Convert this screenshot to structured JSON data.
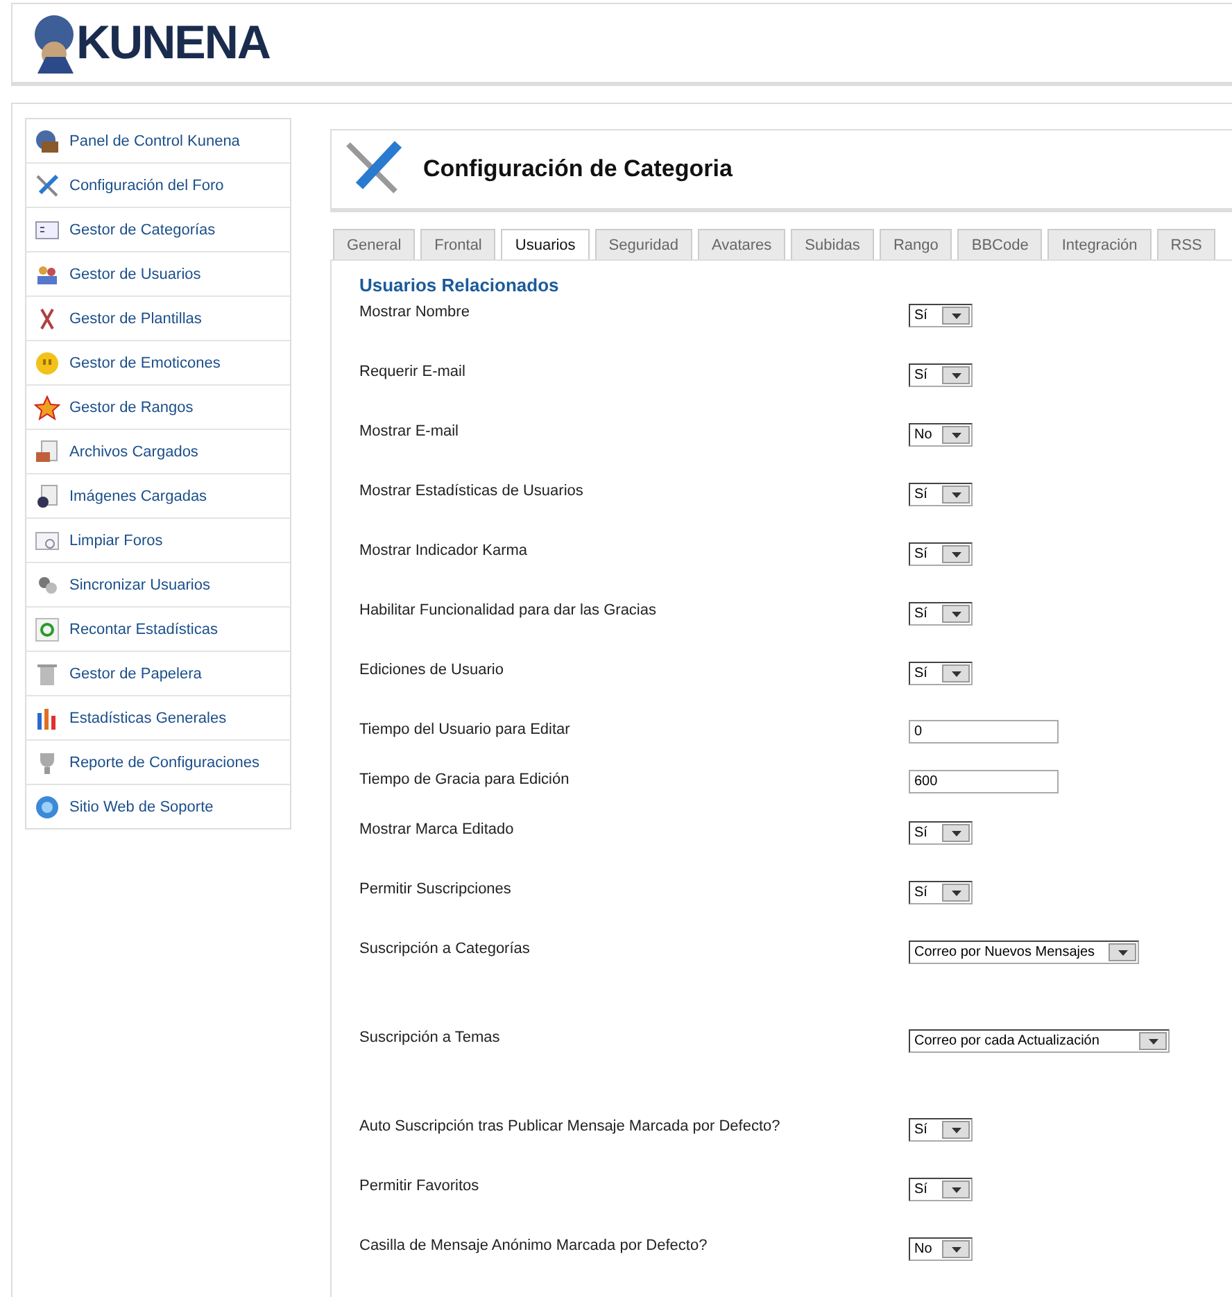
{
  "logo": {
    "text": "KUNENA"
  },
  "sidebar": {
    "items": [
      {
        "label": "Panel de Control Kunena"
      },
      {
        "label": "Configuración del Foro"
      },
      {
        "label": "Gestor de Categorías"
      },
      {
        "label": "Gestor de Usuarios"
      },
      {
        "label": "Gestor de Plantillas"
      },
      {
        "label": "Gestor de Emoticones"
      },
      {
        "label": "Gestor de Rangos"
      },
      {
        "label": "Archivos Cargados"
      },
      {
        "label": "Imágenes Cargadas"
      },
      {
        "label": "Limpiar Foros"
      },
      {
        "label": "Sincronizar Usuarios"
      },
      {
        "label": "Recontar Estadísticas"
      },
      {
        "label": "Gestor de Papelera"
      },
      {
        "label": "Estadísticas Generales"
      },
      {
        "label": "Reporte de Configuraciones"
      },
      {
        "label": "Sitio Web de Soporte"
      }
    ]
  },
  "page": {
    "title": "Configuración de Categoria"
  },
  "tabs": [
    {
      "label": "General",
      "selected": false
    },
    {
      "label": "Frontal",
      "selected": false
    },
    {
      "label": "Usuarios",
      "selected": true
    },
    {
      "label": "Seguridad",
      "selected": false
    },
    {
      "label": "Avatares",
      "selected": false
    },
    {
      "label": "Subidas",
      "selected": false
    },
    {
      "label": "Rango",
      "selected": false
    },
    {
      "label": "BBCode",
      "selected": false
    },
    {
      "label": "Integración",
      "selected": false
    },
    {
      "label": "RSS",
      "selected": false
    }
  ],
  "section": {
    "heading": "Usuarios Relacionados"
  },
  "settings": [
    {
      "label": "Mostrar Nombre",
      "kind": "select",
      "value": "Sí"
    },
    {
      "label": "Requerir E-mail",
      "kind": "select",
      "value": "Sí"
    },
    {
      "label": "Mostrar E-mail",
      "kind": "select",
      "value": "No"
    },
    {
      "label": "Mostrar Estadísticas de Usuarios",
      "kind": "select",
      "value": "Sí"
    },
    {
      "label": "Mostrar Indicador Karma",
      "kind": "select",
      "value": "Sí"
    },
    {
      "label": "Habilitar Funcionalidad para dar las Gracias",
      "kind": "select",
      "value": "Sí"
    },
    {
      "label": "Ediciones de Usuario",
      "kind": "select",
      "value": "Sí"
    },
    {
      "label": "Tiempo del Usuario para Editar",
      "kind": "text",
      "value": "0"
    },
    {
      "label": "Tiempo de Gracia para Edición",
      "kind": "text",
      "value": "600"
    },
    {
      "label": "Mostrar Marca Editado",
      "kind": "select",
      "value": "Sí"
    },
    {
      "label": "Permitir Suscripciones",
      "kind": "select",
      "value": "Sí"
    },
    {
      "label": "Suscripción a Categorías",
      "kind": "long-select",
      "value": "Correo por Nuevos Mensajes"
    },
    {
      "label": "Suscripción a Temas",
      "kind": "long-select",
      "value": "Correo por cada Actualización"
    },
    {
      "label": "Auto Suscripción tras Publicar Mensaje Marcada por Defecto?",
      "kind": "select",
      "value": "Sí"
    },
    {
      "label": "Permitir Favoritos",
      "kind": "select",
      "value": "Sí"
    },
    {
      "label": "Casilla de Mensaje Anónimo Marcada por Defecto?",
      "kind": "select",
      "value": "No"
    }
  ]
}
